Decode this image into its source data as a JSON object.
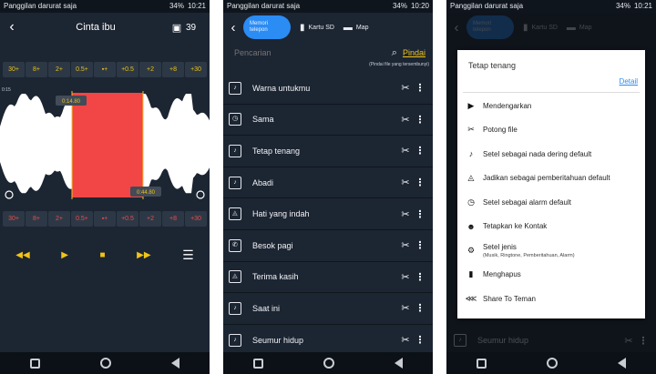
{
  "status": {
    "carrier": "Panggilan darurat saja",
    "battery": "34%",
    "time": "10:21",
    "time_p2": "10:20"
  },
  "editor": {
    "title": "Cinta ibu",
    "count": "39",
    "time_left": "0:15",
    "top_controls": [
      "30+",
      "8+",
      "2+",
      "0.5+",
      "▪+",
      "+0.5",
      "+2",
      "+8",
      "+30"
    ],
    "bottom_controls": [
      "30+",
      "8+",
      "2+",
      "0.5+",
      "▪+",
      "+0.5",
      "+2",
      "+8",
      "+30"
    ],
    "marker_start": "0:14.80",
    "marker_end": "0:44.80",
    "player": {
      "rewind": "◀◀",
      "play": "▶",
      "stop": "■",
      "forward": "▶▶",
      "menu": "☰"
    }
  },
  "library": {
    "tab_active": "Memori telepon",
    "tab_sd": "Kartu SD",
    "tab_map": "Map",
    "search_placeholder": "Pencarian",
    "scan_label": "Pindai",
    "scan_note": "(Pindai file yang tersembunyi)",
    "songs": [
      {
        "title": "Warna untukmu",
        "icon": "♪"
      },
      {
        "title": "Sama",
        "icon": "◷"
      },
      {
        "title": "Tetap tenang",
        "icon": "♪"
      },
      {
        "title": "Abadi",
        "icon": "♪"
      },
      {
        "title": "Hati yang indah",
        "icon": "◬"
      },
      {
        "title": "Besok pagi",
        "icon": "✆"
      },
      {
        "title": "Terima kasih",
        "icon": "◬"
      },
      {
        "title": "Saat ini",
        "icon": "♪"
      },
      {
        "title": "Seumur hidup",
        "icon": "♪"
      }
    ]
  },
  "menu": {
    "song_title": "Tetap tenang",
    "detail_label": "Detail",
    "items": [
      {
        "label": "Mendengarkan",
        "icon": "▶",
        "sub": ""
      },
      {
        "label": "Potong file",
        "icon": "✂",
        "sub": ""
      },
      {
        "label": "Setel sebagai nada dering default",
        "icon": "♪",
        "sub": ""
      },
      {
        "label": "Jadikan sebagai pemberitahuan default",
        "icon": "◬",
        "sub": ""
      },
      {
        "label": "Setel sebagai alarm default",
        "icon": "◷",
        "sub": ""
      },
      {
        "label": "Tetapkan ke Kontak",
        "icon": "☻",
        "sub": ""
      },
      {
        "label": "Setel jenis",
        "icon": "⚙",
        "sub": "(Musik, Ringtone, Pemberitahuan, Alarm)"
      },
      {
        "label": "Menghapus",
        "icon": "▮",
        "sub": ""
      },
      {
        "label": "Share To Teman",
        "icon": "⋘",
        "sub": ""
      }
    ],
    "background_song": "Seumur hidup"
  },
  "icons": {
    "back": "chevron-left-icon",
    "save": "save-icon",
    "search": "search-icon",
    "scissors": "scissors-icon",
    "more": "more-vertical-icon"
  },
  "colors": {
    "accent_yellow": "#f0c419",
    "accent_blue": "#2b8cf4",
    "selection_red": "#f24545",
    "background": "#1c2532"
  }
}
